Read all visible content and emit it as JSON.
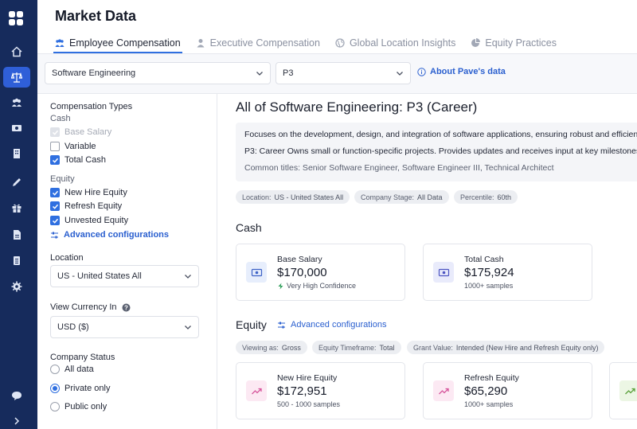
{
  "header": {
    "title": "Market Data",
    "tabs": [
      {
        "label": "Employee Compensation",
        "icon": "users-icon",
        "active": true
      },
      {
        "label": "Executive Compensation",
        "icon": "user-icon",
        "active": false
      },
      {
        "label": "Global Location Insights",
        "icon": "globe-icon",
        "active": false
      },
      {
        "label": "Equity Practices",
        "icon": "pie-chart-icon",
        "active": false
      }
    ]
  },
  "filters": {
    "job_family": "Software Engineering",
    "level": "P3",
    "about_label": "About Pave's data"
  },
  "panel": {
    "comp_types_heading": "Compensation Types",
    "cash_heading": "Cash",
    "cash_items": [
      {
        "label": "Base Salary",
        "checked": true,
        "disabled": true
      },
      {
        "label": "Variable",
        "checked": false,
        "disabled": false
      },
      {
        "label": "Total Cash",
        "checked": true,
        "disabled": false
      }
    ],
    "equity_heading": "Equity",
    "equity_items": [
      {
        "label": "New Hire Equity",
        "checked": true
      },
      {
        "label": "Refresh Equity",
        "checked": true
      },
      {
        "label": "Unvested Equity",
        "checked": true
      }
    ],
    "advanced_label": "Advanced configurations",
    "location_heading": "Location",
    "location_value": "US - United States All",
    "currency_heading": "View Currency In",
    "currency_value": "USD ($)",
    "status_heading": "Company Status",
    "status_options": [
      {
        "label": "All data",
        "selected": false
      },
      {
        "label": "Private only",
        "selected": true
      },
      {
        "label": "Public only",
        "selected": false
      }
    ]
  },
  "main": {
    "title": "All of Software Engineering: P3 (Career)",
    "description": "Focuses on the development, design, and integration of software applications, ensuring robust and efficient",
    "level_desc": "P3: Career Owns small or function-specific projects. Provides updates and receives input at key milestones",
    "common_titles": "Common titles: Senior Software Engineer, Software Engineer III, Technical Architect",
    "chips": [
      {
        "key": "Location:",
        "value": "US - United States All"
      },
      {
        "key": "Company Stage:",
        "value": "All Data"
      },
      {
        "key": "Percentile:",
        "value": "60th"
      }
    ],
    "cash_heading": "Cash",
    "cash_cards": [
      {
        "label": "Base Salary",
        "value": "$170,000",
        "sub": "Very High Confidence",
        "icon": "money-icon"
      },
      {
        "label": "Total Cash",
        "value": "$175,924",
        "sub": "1000+ samples",
        "icon": "money-icon"
      }
    ],
    "equity_heading": "Equity",
    "equity_advanced": "Advanced configurations",
    "equity_chips": [
      {
        "key": "Viewing as:",
        "value": "Gross"
      },
      {
        "key": "Equity Timeframe:",
        "value": "Total"
      },
      {
        "key": "Grant Value:",
        "value": "Intended (New Hire and Refresh Equity only)"
      }
    ],
    "equity_cards": [
      {
        "label": "New Hire Equity",
        "value": "$172,951",
        "sub": "500 - 1000 samples",
        "icon": "trend-up-icon"
      },
      {
        "label": "Refresh Equity",
        "value": "$65,290",
        "sub": "1000+ samples",
        "icon": "trend-up-icon"
      }
    ]
  },
  "colors": {
    "nav": "#162b5c",
    "accent": "#2f6fe0",
    "link": "#2a5fcf"
  }
}
